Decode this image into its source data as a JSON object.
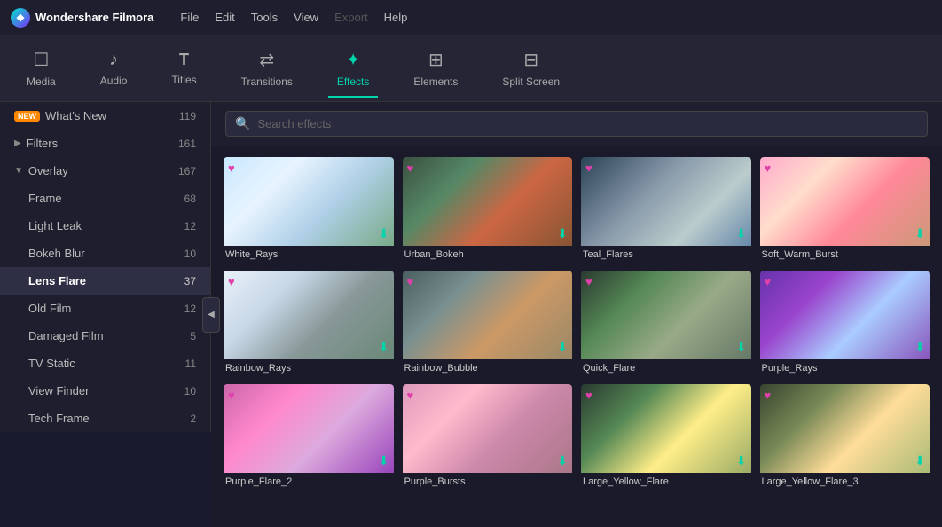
{
  "app": {
    "name": "Wondershare Filmora",
    "logo_symbol": "◆"
  },
  "topmenu": {
    "items": [
      "File",
      "Edit",
      "Tools",
      "View",
      "Export",
      "Help"
    ],
    "disabled": [
      "Export"
    ]
  },
  "navtabs": {
    "tabs": [
      {
        "id": "media",
        "label": "Media",
        "icon": "☐"
      },
      {
        "id": "audio",
        "label": "Audio",
        "icon": "♪"
      },
      {
        "id": "titles",
        "label": "Titles",
        "icon": "T"
      },
      {
        "id": "transitions",
        "label": "Transitions",
        "icon": "⇄"
      },
      {
        "id": "effects",
        "label": "Effects",
        "icon": "✦"
      },
      {
        "id": "elements",
        "label": "Elements",
        "icon": "⊞"
      },
      {
        "id": "split-screen",
        "label": "Split Screen",
        "icon": "⊟"
      }
    ],
    "active": "effects"
  },
  "sidebar": {
    "items": [
      {
        "id": "whats-new",
        "label": "What's New",
        "count": 119,
        "is_new": true,
        "indent": 0,
        "arrow": ""
      },
      {
        "id": "filters",
        "label": "Filters",
        "count": 161,
        "indent": 0,
        "arrow": "▶"
      },
      {
        "id": "overlay",
        "label": "Overlay",
        "count": 167,
        "indent": 0,
        "arrow": "▼",
        "expanded": true
      },
      {
        "id": "frame",
        "label": "Frame",
        "count": 68,
        "indent": 1
      },
      {
        "id": "light-leak",
        "label": "Light Leak",
        "count": 12,
        "indent": 1
      },
      {
        "id": "bokeh-blur",
        "label": "Bokeh Blur",
        "count": 10,
        "indent": 1
      },
      {
        "id": "lens-flare",
        "label": "Lens Flare",
        "count": 37,
        "indent": 1,
        "active": true
      },
      {
        "id": "old-film",
        "label": "Old Film",
        "count": 12,
        "indent": 1
      },
      {
        "id": "damaged-film",
        "label": "Damaged Film",
        "count": 5,
        "indent": 1
      },
      {
        "id": "tv-static",
        "label": "TV Static",
        "count": 11,
        "indent": 1
      },
      {
        "id": "view-finder",
        "label": "View Finder",
        "count": 10,
        "indent": 1
      },
      {
        "id": "tech-frame",
        "label": "Tech Frame",
        "count": 2,
        "indent": 1
      }
    ]
  },
  "search": {
    "placeholder": "Search effects"
  },
  "effects_grid": {
    "items": [
      {
        "id": "white-rays",
        "label": "White_Rays",
        "thumb_class": "thumb-white-rays"
      },
      {
        "id": "urban-bokeh",
        "label": "Urban_Bokeh",
        "thumb_class": "thumb-urban-bokeh"
      },
      {
        "id": "teal-flares",
        "label": "Teal_Flares",
        "thumb_class": "thumb-teal-flares"
      },
      {
        "id": "soft-warm-burst",
        "label": "Soft_Warm_Burst",
        "thumb_class": "thumb-soft-warm"
      },
      {
        "id": "rainbow-rays",
        "label": "Rainbow_Rays",
        "thumb_class": "thumb-rainbow-rays"
      },
      {
        "id": "rainbow-bubble",
        "label": "Rainbow_Bubble",
        "thumb_class": "thumb-rainbow-bubble"
      },
      {
        "id": "quick-flare",
        "label": "Quick_Flare",
        "thumb_class": "thumb-quick-flare"
      },
      {
        "id": "purple-rays",
        "label": "Purple_Rays",
        "thumb_class": "thumb-purple-rays"
      },
      {
        "id": "purple-flare2",
        "label": "Purple_Flare_2",
        "thumb_class": "thumb-purple-flare2"
      },
      {
        "id": "purple-bursts",
        "label": "Purple_Bursts",
        "thumb_class": "thumb-purple-bursts"
      },
      {
        "id": "large-yellow-flare",
        "label": "Large_Yellow_Flare",
        "thumb_class": "thumb-large-yellow"
      },
      {
        "id": "large-yellow-flare3",
        "label": "Large_Yellow_Flare_3",
        "thumb_class": "thumb-large-yellow3"
      }
    ]
  },
  "colors": {
    "accent": "#00d4aa",
    "heart": "#e040aa",
    "active_bg": "#2e2e45",
    "new_badge": "#ff8800"
  }
}
